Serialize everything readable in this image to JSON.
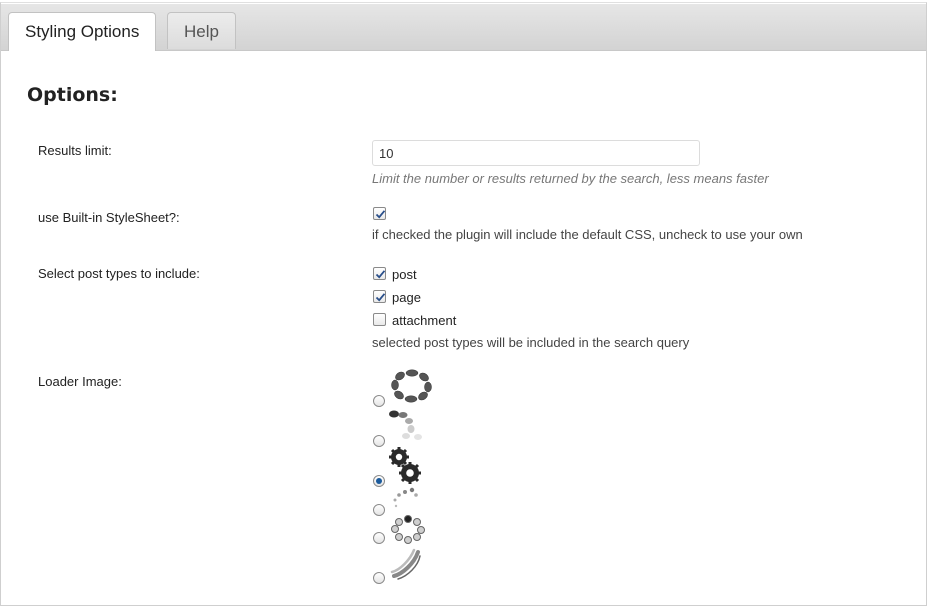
{
  "tabs": [
    {
      "label": "Styling Options",
      "active": true
    },
    {
      "label": "Help",
      "active": false
    }
  ],
  "section_title": "Options:",
  "results_limit": {
    "label": "Results limit:",
    "value": "10",
    "hint": "Limit the number or results returned by the search, less means faster"
  },
  "stylesheet": {
    "label": "use Built-in StyleSheet?:",
    "checked": true,
    "hint": "if checked the plugin will include the default CSS, uncheck to use your own"
  },
  "post_types": {
    "label": "Select post types to include:",
    "items": [
      {
        "label": "post",
        "checked": true
      },
      {
        "label": "page",
        "checked": true
      },
      {
        "label": "attachment",
        "checked": false
      }
    ],
    "hint": "selected post types will be included in the search query"
  },
  "loader_image": {
    "label": "Loader Image:",
    "options": [
      {
        "icon": "ring-segments-loader-icon",
        "selected": false
      },
      {
        "icon": "fading-dots-arc-loader-icon",
        "selected": false
      },
      {
        "icon": "gear-loader-icon",
        "selected": true
      },
      {
        "icon": "small-dots-spiral-loader-icon",
        "selected": false
      },
      {
        "icon": "bead-circle-loader-icon",
        "selected": false
      },
      {
        "icon": "swirl-loader-icon",
        "selected": false
      }
    ]
  },
  "colors": {
    "accent": "#1a5a9c"
  }
}
